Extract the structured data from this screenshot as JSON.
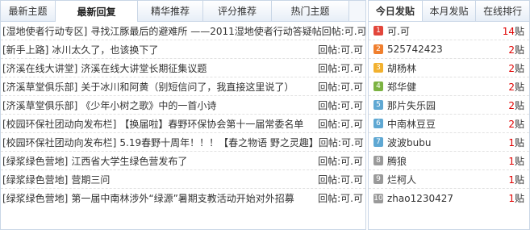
{
  "left_tabs": [
    {
      "label": "最新主题",
      "active": false,
      "width": 68
    },
    {
      "label": "最新回复",
      "active": true,
      "width": 102
    },
    {
      "label": "精华推荐",
      "active": false,
      "width": 81
    },
    {
      "label": "评分推荐",
      "active": false,
      "width": 85
    },
    {
      "label": "热门主题",
      "active": false,
      "width": 96
    }
  ],
  "threads": [
    {
      "category": "[湿地使者行动专区]",
      "title": "寻找江豚最后的避难所 ——2011湿地使者行动答疑帖",
      "reply": "回帖:可.可"
    },
    {
      "category": "[新手上路]",
      "title": "冰川太久了，也该换下了",
      "reply": "回帖:可.可"
    },
    {
      "category": "[济溪在线大讲堂]",
      "title": "济溪在线大讲堂长期征集议题",
      "reply": "回帖:可.可"
    },
    {
      "category": "[济溪草堂俱乐部]",
      "title": "关于冰川和阿黄（别短信问了，我直接这里说了）",
      "reply": "回帖:可.可"
    },
    {
      "category": "[济溪草堂俱乐部]",
      "title": "《少年小树之歌》中的一首小诗",
      "reply": "回帖:可.可"
    },
    {
      "category": "[校园环保社团动向发布栏]",
      "title": "【换届啦】春野环保协会第十一届常委名单",
      "reply": "回帖:可.可"
    },
    {
      "category": "[校园环保社团动向发布栏]",
      "title": "5.19春野十周年！！！【春之物语 野之灵趣】",
      "reply": "回帖:可.可"
    },
    {
      "category": "[绿浆绿色营地]",
      "title": "江西省大学生绿色营发布了",
      "reply": "回帖:可.可"
    },
    {
      "category": "[绿浆绿色营地]",
      "title": "营期三问",
      "reply": "回帖:可.可"
    },
    {
      "category": "[绿浆绿色营地]",
      "title": "第一届中南林涉外“绿源”暑期支教活动开始对外招募",
      "reply": "回帖:可.可"
    }
  ],
  "right_tabs": [
    {
      "label": "今日发贴",
      "active": true
    },
    {
      "label": "本月发贴",
      "active": false
    },
    {
      "label": "在线排行",
      "active": false
    }
  ],
  "ranking": [
    {
      "rank": "1",
      "name": "可.可",
      "count": "14",
      "unit": "贴",
      "color": "#e2463b"
    },
    {
      "rank": "2",
      "name": "525742423",
      "count": "2",
      "unit": "贴",
      "color": "#f07f2e"
    },
    {
      "rank": "3",
      "name": "胡杨林",
      "count": "2",
      "unit": "贴",
      "color": "#f2b12f"
    },
    {
      "rank": "4",
      "name": "郑华健",
      "count": "2",
      "unit": "贴",
      "color": "#7cb342"
    },
    {
      "rank": "5",
      "name": "那片失乐园",
      "count": "2",
      "unit": "贴",
      "color": "#5fa8d3"
    },
    {
      "rank": "6",
      "name": "中南林豆豆",
      "count": "2",
      "unit": "贴",
      "color": "#5fa8d3"
    },
    {
      "rank": "7",
      "name": "波波bubu",
      "count": "1",
      "unit": "贴",
      "color": "#5fa8d3"
    },
    {
      "rank": "8",
      "name": "腾狼",
      "count": "1",
      "unit": "贴",
      "color": "#9a9a9a"
    },
    {
      "rank": "9",
      "name": "烂柯人",
      "count": "1",
      "unit": "贴",
      "color": "#9a9a9a"
    },
    {
      "rank": "10",
      "name": "zhao1230427",
      "count": "1",
      "unit": "贴",
      "color": "#9a9a9a"
    }
  ]
}
